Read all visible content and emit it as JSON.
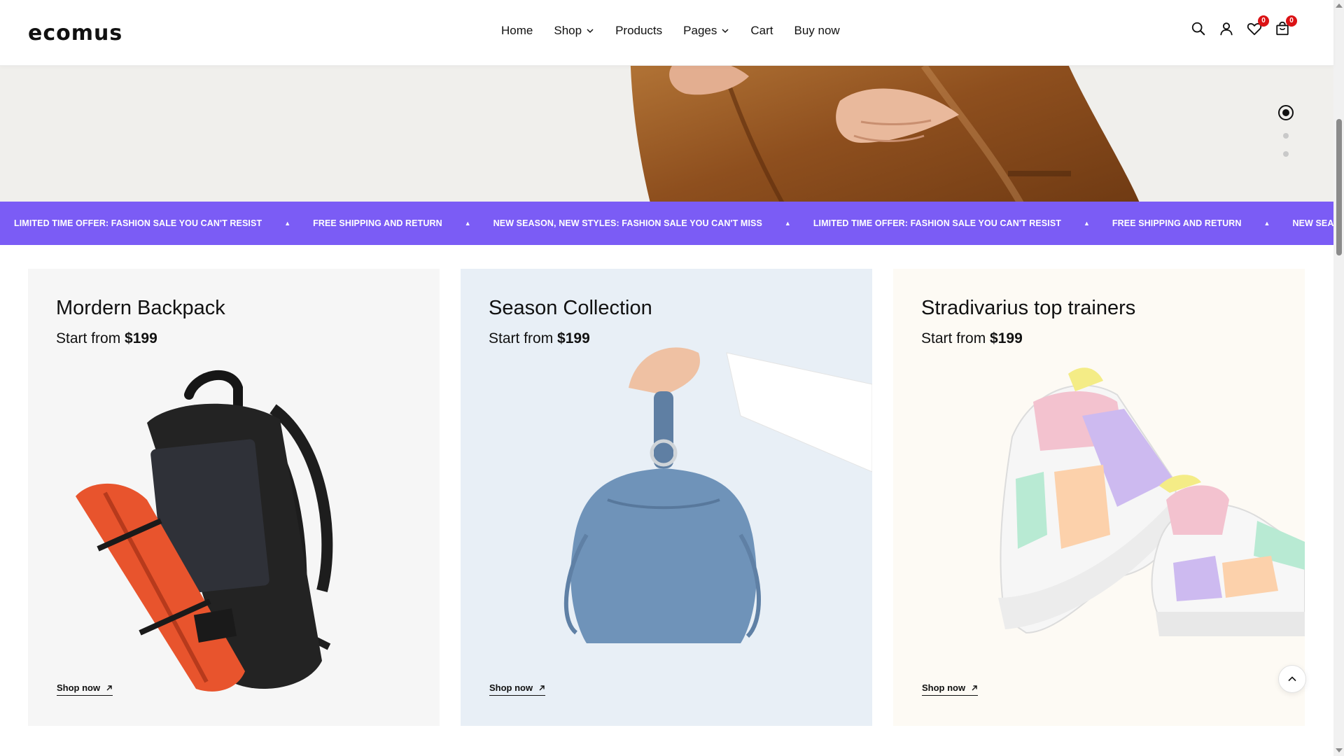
{
  "brand": {
    "logo": "ecomus"
  },
  "nav": {
    "items": [
      {
        "label": "Home",
        "has_dropdown": false
      },
      {
        "label": "Shop",
        "has_dropdown": true
      },
      {
        "label": "Products",
        "has_dropdown": false
      },
      {
        "label": "Pages",
        "has_dropdown": true
      },
      {
        "label": "Cart",
        "has_dropdown": false
      },
      {
        "label": "Buy now",
        "has_dropdown": false
      }
    ]
  },
  "header_icons": {
    "search": "search-icon",
    "account": "user-icon",
    "wishlist": "heart-icon",
    "wishlist_count": "0",
    "cart": "shopping-bag-icon",
    "cart_count": "0"
  },
  "hero": {
    "slides": 3,
    "active_slide": 1
  },
  "marquee": {
    "items": [
      "LIMITED TIME OFFER: FASHION SALE YOU CAN'T RESIST",
      "FREE SHIPPING AND RETURN",
      "NEW SEASON, NEW STYLES: FASHION SALE YOU CAN'T MISS",
      "LIMITED TIME OFFER: FASHION SALE YOU CAN'T RESIST",
      "FREE SHIPPING AND RETURN",
      "NEW SEASON, NEW STYLES: FASHION"
    ],
    "separator": "▲",
    "background": "#7b5cf5"
  },
  "collections": [
    {
      "title": "Mordern Backpack",
      "prefix": "Start from ",
      "price": "$199",
      "link": "Shop now",
      "bg": "#f6f6f6"
    },
    {
      "title": "Season Collection",
      "prefix": "Start from ",
      "price": "$199",
      "link": "Shop now",
      "bg": "#e8eff6"
    },
    {
      "title": "Stradivarius top trainers",
      "prefix": "Start from ",
      "price": "$199",
      "link": "Shop now",
      "bg": "#fdfaf4"
    }
  ],
  "colors": {
    "badge": "#db1215",
    "text": "#111111"
  }
}
